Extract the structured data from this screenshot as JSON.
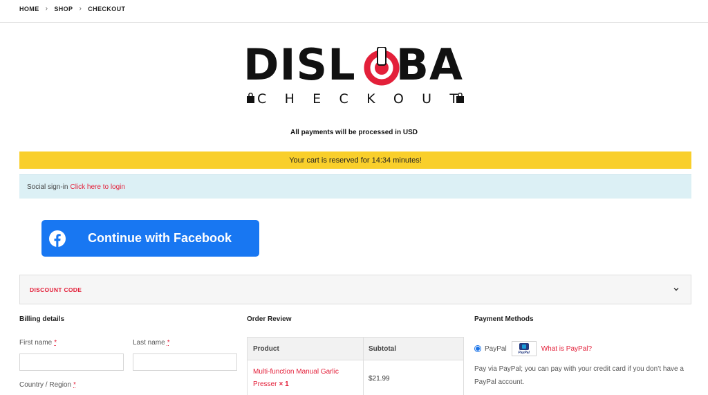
{
  "breadcrumb": {
    "home": "HOME",
    "shop": "SHOP",
    "checkout": "CHECKOUT"
  },
  "logo": {
    "main_left": "DISL",
    "main_right": "BA",
    "sub": [
      "C",
      "H",
      "E",
      "C",
      "K",
      "O",
      "U",
      "T"
    ]
  },
  "currency_notice": "All payments will be processed in USD",
  "reserve_notice": "Your cart is reserved for 14:34 minutes!",
  "social": {
    "label": "Social sign-in",
    "link": "Click here to login"
  },
  "facebook_button": "Continue with Facebook",
  "discount": {
    "label": "DISCOUNT CODE"
  },
  "billing": {
    "title": "Billing details",
    "first_name": "First name",
    "last_name": "Last name",
    "country": "Country / Region",
    "required_mark": "*"
  },
  "order_review": {
    "title": "Order Review",
    "headers": {
      "product": "Product",
      "subtotal": "Subtotal"
    },
    "items": [
      {
        "name_line1": "Multi-function Manual Garlic",
        "name_line2": "Presser",
        "qty": "× 1",
        "subtotal": "$21.99"
      }
    ]
  },
  "payment": {
    "title": "Payment Methods",
    "method": "PayPal",
    "logo_text": "PayPal",
    "link": "What is PayPal?",
    "description": "Pay via PayPal; you can pay with your credit card if you don’t have a PayPal account."
  },
  "colors": {
    "accent": "#e3203a",
    "reserve_bg": "#f9cf2b",
    "social_bg": "#dcf0f5",
    "facebook": "#1877f2"
  },
  "icons": {
    "facebook": "facebook-icon",
    "chevron": "chevron-down-icon",
    "power": "power-icon",
    "bag": "shopping-bag-icon"
  }
}
